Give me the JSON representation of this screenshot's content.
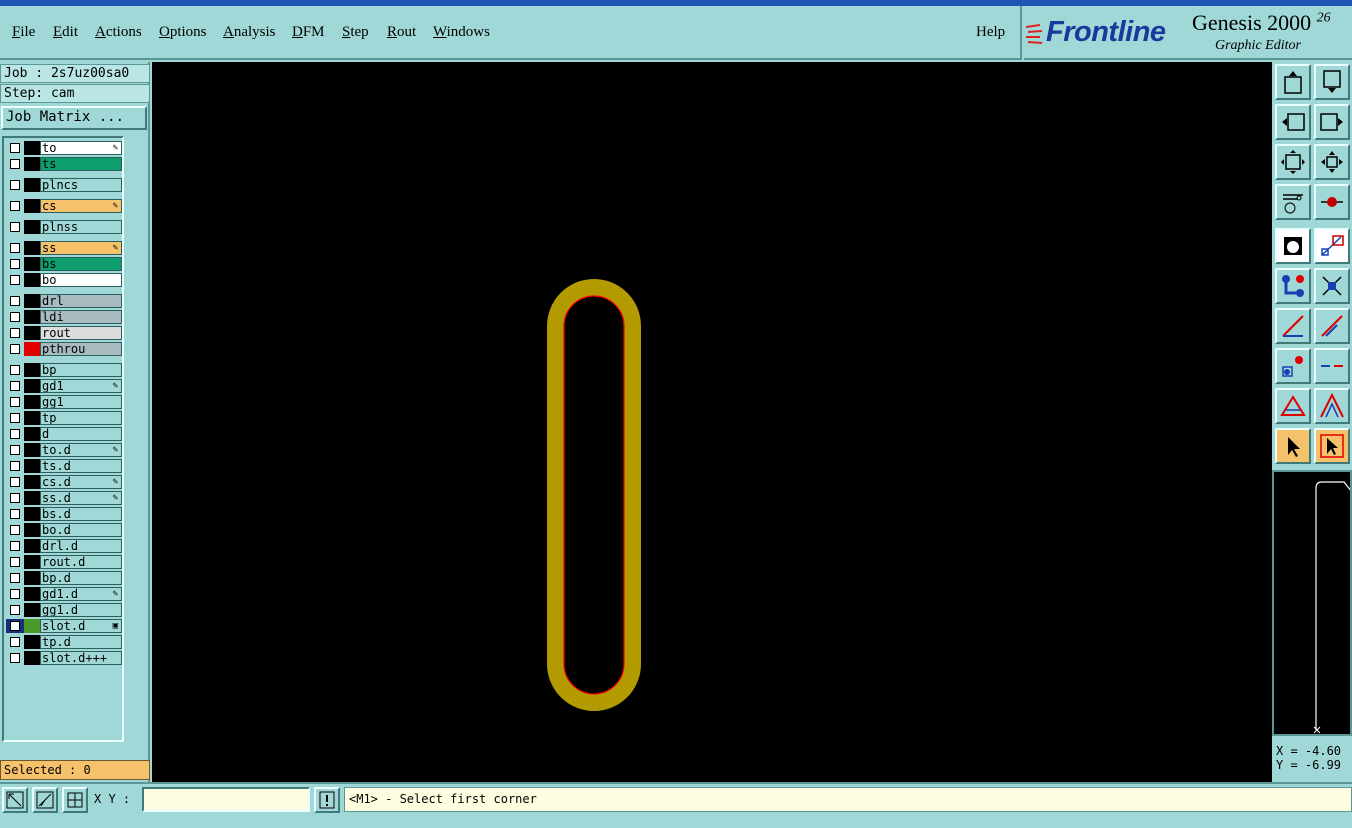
{
  "menu": {
    "items": [
      "File",
      "Edit",
      "Actions",
      "Options",
      "Analysis",
      "DFM",
      "Step",
      "Rout",
      "Windows"
    ],
    "help": "Help"
  },
  "brand": {
    "logo": "Frontline",
    "title": "Genesis 2000",
    "version": "26",
    "subtitle": "Graphic Editor"
  },
  "job": {
    "job_label": "Job : 2s7uz00sa0",
    "step_label": "Step: cam",
    "matrix_button": "Job Matrix ..."
  },
  "layers": [
    {
      "name": "to",
      "color": "#ffffff",
      "mark": "✎"
    },
    {
      "name": "ts",
      "color": "#0e9e6e",
      "mark": ""
    },
    {
      "name": "plncs",
      "color": "#9fd8d6",
      "mark": ""
    },
    {
      "name": "cs",
      "color": "#f5c26b",
      "mark": "✎"
    },
    {
      "name": "plnss",
      "color": "#9fd8d6",
      "mark": ""
    },
    {
      "name": "ss",
      "color": "#f5c26b",
      "mark": "✎"
    },
    {
      "name": "bs",
      "color": "#0e9e6e",
      "mark": ""
    },
    {
      "name": "bo",
      "color": "#ffffff",
      "mark": ""
    },
    {
      "name": "drl",
      "color": "#a8bcc0",
      "mark": ""
    },
    {
      "name": "ldi",
      "color": "#a8bcc0",
      "mark": ""
    },
    {
      "name": "rout",
      "color": "#dcdcdc",
      "mark": ""
    },
    {
      "name": "pthrou",
      "color": "#a8bcc0",
      "mark": "",
      "swatch": "#e00000"
    },
    {
      "name": "bp",
      "color": "#9fd8d6",
      "mark": ""
    },
    {
      "name": "gd1",
      "color": "#9fd8d6",
      "mark": "✎"
    },
    {
      "name": "gg1",
      "color": "#9fd8d6",
      "mark": ""
    },
    {
      "name": "tp",
      "color": "#9fd8d6",
      "mark": ""
    },
    {
      "name": "d",
      "color": "#9fd8d6",
      "mark": ""
    },
    {
      "name": "to.d",
      "color": "#9fd8d6",
      "mark": "✎"
    },
    {
      "name": "ts.d",
      "color": "#9fd8d6",
      "mark": ""
    },
    {
      "name": "cs.d",
      "color": "#9fd8d6",
      "mark": "✎"
    },
    {
      "name": "ss.d",
      "color": "#9fd8d6",
      "mark": "✎"
    },
    {
      "name": "bs.d",
      "color": "#9fd8d6",
      "mark": ""
    },
    {
      "name": "bo.d",
      "color": "#9fd8d6",
      "mark": ""
    },
    {
      "name": "drl.d",
      "color": "#9fd8d6",
      "mark": ""
    },
    {
      "name": "rout.d",
      "color": "#9fd8d6",
      "mark": ""
    },
    {
      "name": "bp.d",
      "color": "#9fd8d6",
      "mark": ""
    },
    {
      "name": "gd1.d",
      "color": "#9fd8d6",
      "mark": "✎"
    },
    {
      "name": "gg1.d",
      "color": "#9fd8d6",
      "mark": ""
    },
    {
      "name": "slot.d",
      "color": "#9fd8d6",
      "mark": "▣",
      "swatch": "#4a9a2a",
      "active": true
    },
    {
      "name": "tp.d",
      "color": "#9fd8d6",
      "mark": ""
    },
    {
      "name": "slot.d+++",
      "color": "#9fd8d6",
      "mark": ""
    }
  ],
  "selected_label": "Selected : 0",
  "coords": {
    "x": "X = -4.60",
    "y": "Y = -6.99"
  },
  "bottom": {
    "xy_label": "X Y :",
    "xy_value": "",
    "message": "<M1> - Select first corner"
  },
  "colors": {
    "feature_fill": "#b39a00",
    "feature_outline": "#ff0000",
    "canvas_bg": "#000000",
    "panel_bg": "#9fd8d6"
  },
  "icons": {
    "right_toolbar": [
      "pan-up-icon",
      "pan-down-icon",
      "pan-left-icon",
      "pan-right-icon",
      "zoom-fit-icon",
      "zoom-center-icon",
      "measure-tool-icon",
      "snap-pad-icon",
      "select-feature-icon",
      "select-outline-icon",
      "connect-nodes-icon",
      "cross-select-icon",
      "line-select-icon",
      "line-select-alt-icon",
      "pad-select-icon",
      "line-split-icon",
      "triangle-arc-icon",
      "triangle-arc-alt-icon",
      "pointer-icon",
      "pointer-boxed-icon"
    ],
    "bottom": [
      "zoom-area-icon",
      "zoom-line-icon",
      "grid-icon",
      "exclaim-icon"
    ]
  }
}
